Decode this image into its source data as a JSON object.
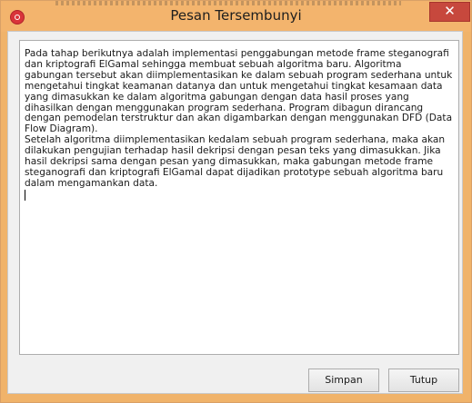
{
  "window": {
    "title": "Pesan Tersembunyi",
    "close_glyph": "✕"
  },
  "message": {
    "paragraphs": [
      "Pada tahap berikutnya adalah implementasi penggabungan metode frame steganografi dan kriptografi ElGamal sehingga membuat sebuah algoritma baru. Algoritma gabungan tersebut akan diimplementasikan ke dalam sebuah program sederhana untuk mengetahui tingkat keamanan datanya dan untuk mengetahui tingkat kesamaan data yang dimasukkan ke dalam algoritma gabungan dengan data hasil proses yang dihasilkan dengan menggunakan program sederhana. Program dibagun dirancang dengan pemodelan terstruktur dan akan digambarkan dengan menggunakan DFD (Data Flow Diagram).",
      "Setelah algoritma diimplementasikan kedalam sebuah program sederhana, maka akan dilakukan pengujian terhadap hasil dekripsi dengan pesan teks yang dimasukkan. Jika hasil dekripsi sama dengan pesan yang dimasukkan, maka gabungan metode frame steganografi dan kriptografi ElGamal dapat dijadikan prototype sebuah algoritma baru dalam mengamankan data."
    ]
  },
  "buttons": {
    "save": "Simpan",
    "close": "Tutup"
  },
  "icons": {
    "app": "app-icon",
    "close": "close-icon"
  },
  "colors": {
    "titlebar": "#f3b46d",
    "close_button": "#c7483d",
    "dialog_background": "#f0f0f0"
  }
}
